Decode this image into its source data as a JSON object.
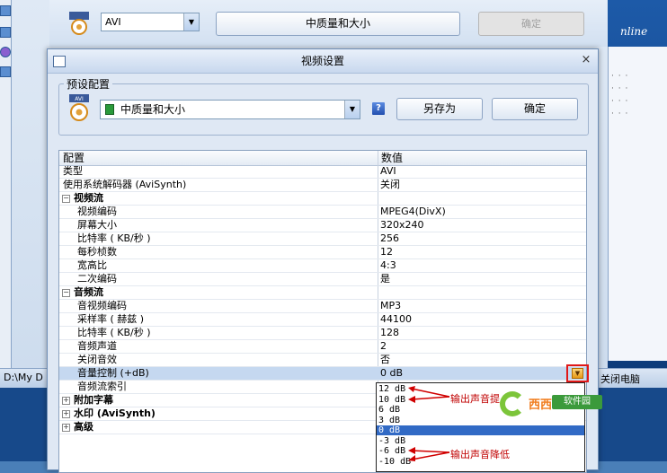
{
  "background": {
    "format_select": "AVI",
    "quality_button": "中质量和大小",
    "ok_button": "确定",
    "right_logo": "nline",
    "taskbar_path": "D:\\My D",
    "taskbar_shutdown": "关闭电脑"
  },
  "dialog": {
    "title": "视频设置",
    "close_glyph": "×",
    "preset_group_label": "预设配置",
    "preset_value": "中质量和大小",
    "help_label": "?",
    "save_as_button": "另存为",
    "ok_button": "确定"
  },
  "grid": {
    "col_name": "配置",
    "col_value": "数值",
    "rows": [
      {
        "name": "类型",
        "value": "AVI"
      },
      {
        "name": "使用系统解码器 (AviSynth)",
        "value": "关闭"
      },
      {
        "name": "视频流",
        "value": "",
        "expander": "−"
      },
      {
        "name": "视频编码",
        "value": "MPEG4(DivX)"
      },
      {
        "name": "屏幕大小",
        "value": "320x240"
      },
      {
        "name": "比特率 ( KB/秒 )",
        "value": "256"
      },
      {
        "name": "每秒桢数",
        "value": "12"
      },
      {
        "name": "宽高比",
        "value": "4:3"
      },
      {
        "name": "二次编码",
        "value": "是"
      },
      {
        "name": "音频流",
        "value": "",
        "expander": "−"
      },
      {
        "name": "音视频编码",
        "value": "MP3"
      },
      {
        "name": "采样率 ( 赫兹 )",
        "value": "44100"
      },
      {
        "name": "比特率 ( KB/秒 )",
        "value": "128"
      },
      {
        "name": "音频声道",
        "value": "2"
      },
      {
        "name": "关闭音效",
        "value": "否"
      },
      {
        "name": "音量控制 (+dB)",
        "value": "0 dB"
      },
      {
        "name": "音频流索引",
        "value": ""
      },
      {
        "name": "附加字幕",
        "value": "",
        "expander": "+"
      },
      {
        "name": "水印 (AviSynth)",
        "value": "",
        "expander": "+"
      },
      {
        "name": "高级",
        "value": "",
        "expander": "+"
      }
    ],
    "dropdown_arrow": "▼"
  },
  "volume_dropdown": {
    "options": [
      "12 dB",
      "10 dB",
      "6 dB",
      "3 dB",
      "0 dB",
      "-3 dB",
      "-6 dB",
      "-10 dB"
    ],
    "selected": "0 dB"
  },
  "annotations": {
    "raise": "输出声音提",
    "lower": "输出声音降低"
  },
  "watermark": {
    "brand": "西西",
    "sub": "软件园"
  },
  "colors": {
    "selection": "#316ac5",
    "annotation": "#c00000",
    "highlight_box": "#e01818"
  }
}
